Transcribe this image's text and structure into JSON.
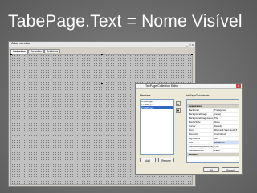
{
  "slide": {
    "title": "TabePage.Text = Nome Visível"
  },
  "form": {
    "title": "Atlas vendas",
    "window_controls": "_ □ x",
    "tabs": [
      {
        "label": "Cadastros"
      },
      {
        "label": "Consultas"
      },
      {
        "label": "Relatórios"
      }
    ]
  },
  "dialog": {
    "title": "TabPage Collection Editor",
    "close": "x",
    "members_label": "Members:",
    "members": [
      "0 tabPage1",
      "1 tabPage2",
      "2 tabPage3"
    ],
    "properties_label": "tabPage3 properties:",
    "add_label": "Add",
    "remove_label": "Remove",
    "ok_label": "OK",
    "cancel_label": "Cancel",
    "up_arrow": "▲",
    "down_arrow": "▼",
    "properties": [
      {
        "name": "Appearance",
        "value": "",
        "category": true
      },
      {
        "name": "BackColor",
        "value": "Transparent"
      },
      {
        "name": "BackgroundImage",
        "value": "(none)"
      },
      {
        "name": "BackgroundImageLayout",
        "value": "Tile"
      },
      {
        "name": "BorderStyle",
        "value": "None"
      },
      {
        "name": "Cursor",
        "value": "Default"
      },
      {
        "name": "Font",
        "value": "Microsoft Sans Serif, 8"
      },
      {
        "name": "ForeColor",
        "value": "ControlText"
      },
      {
        "name": "RightToLeft",
        "value": "No"
      },
      {
        "name": "Text",
        "value": "Relatórios",
        "highlight": true
      },
      {
        "name": "UseVisualStyleBackColor",
        "value": "True"
      },
      {
        "name": "UseWaitCursor",
        "value": "False"
      },
      {
        "name": "Behavior",
        "value": "",
        "category": true
      }
    ]
  }
}
